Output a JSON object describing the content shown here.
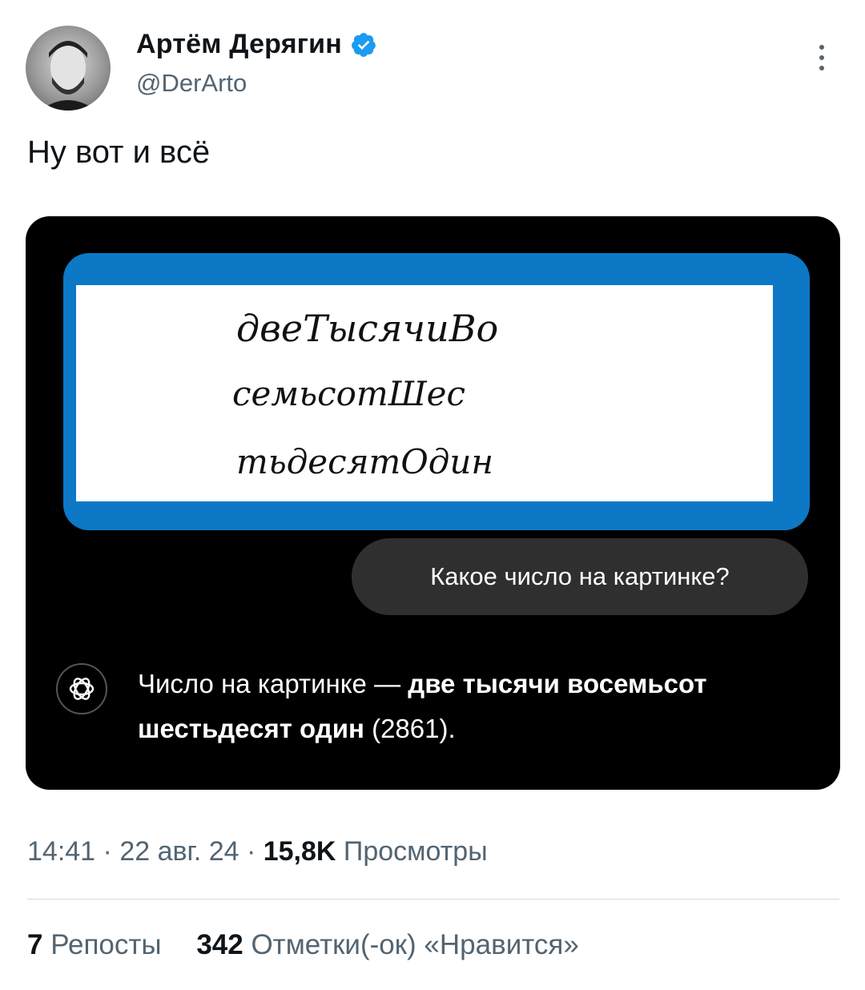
{
  "author": {
    "name": "Артём Дерягин",
    "handle": "@DerArto"
  },
  "tweet": {
    "text": "Ну вот и всё"
  },
  "media": {
    "handwriting_lines": [
      "двеТысячиВо",
      "семьсотШес",
      "тьдесятОдин"
    ],
    "question": "Какое число на картинке?",
    "answer_prefix": "Число на картинке — ",
    "answer_bold": "две тысячи восемьсот шестьдесят один",
    "answer_suffix": " (2861)."
  },
  "meta": {
    "time": "14:41",
    "sep1": " · ",
    "date": "22 авг. 24",
    "sep2": " · ",
    "views_count": "15,8K",
    "views_label": " Просмотры"
  },
  "stats": {
    "reposts_count": "7",
    "reposts_label": " Репосты",
    "likes_count": "342",
    "likes_label": " Отметки(-ок) «Нравится»"
  },
  "colors": {
    "verified": "#1d9bf0",
    "frame": "#0c78c6",
    "bubble": "#2f2f2f"
  }
}
